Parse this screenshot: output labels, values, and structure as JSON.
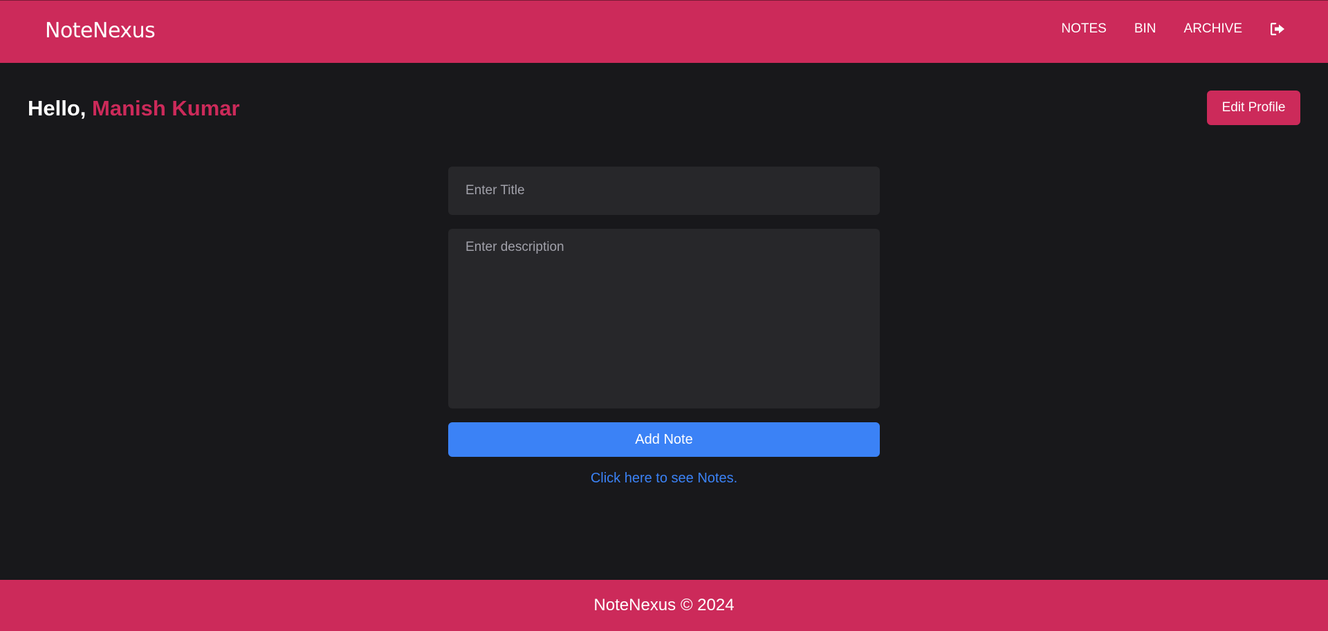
{
  "colors": {
    "brand": "#cc2a5a",
    "background": "#18181b",
    "input_bg": "#27272a",
    "primary": "#3b82f6"
  },
  "header": {
    "brand": "NoteNexus",
    "nav": {
      "notes": "NOTES",
      "bin": "BIN",
      "archive": "ARCHIVE",
      "logout_icon": "sign-out-icon"
    }
  },
  "greeting": {
    "prefix": "Hello, ",
    "name": "Manish Kumar"
  },
  "edit_profile_label": "Edit Profile",
  "form": {
    "title_placeholder": "Enter Title",
    "title_value": "",
    "description_placeholder": "Enter description",
    "description_value": "",
    "submit_label": "Add Note"
  },
  "see_notes_link": "Click here to see Notes.",
  "footer": {
    "text": "NoteNexus © 2024"
  }
}
